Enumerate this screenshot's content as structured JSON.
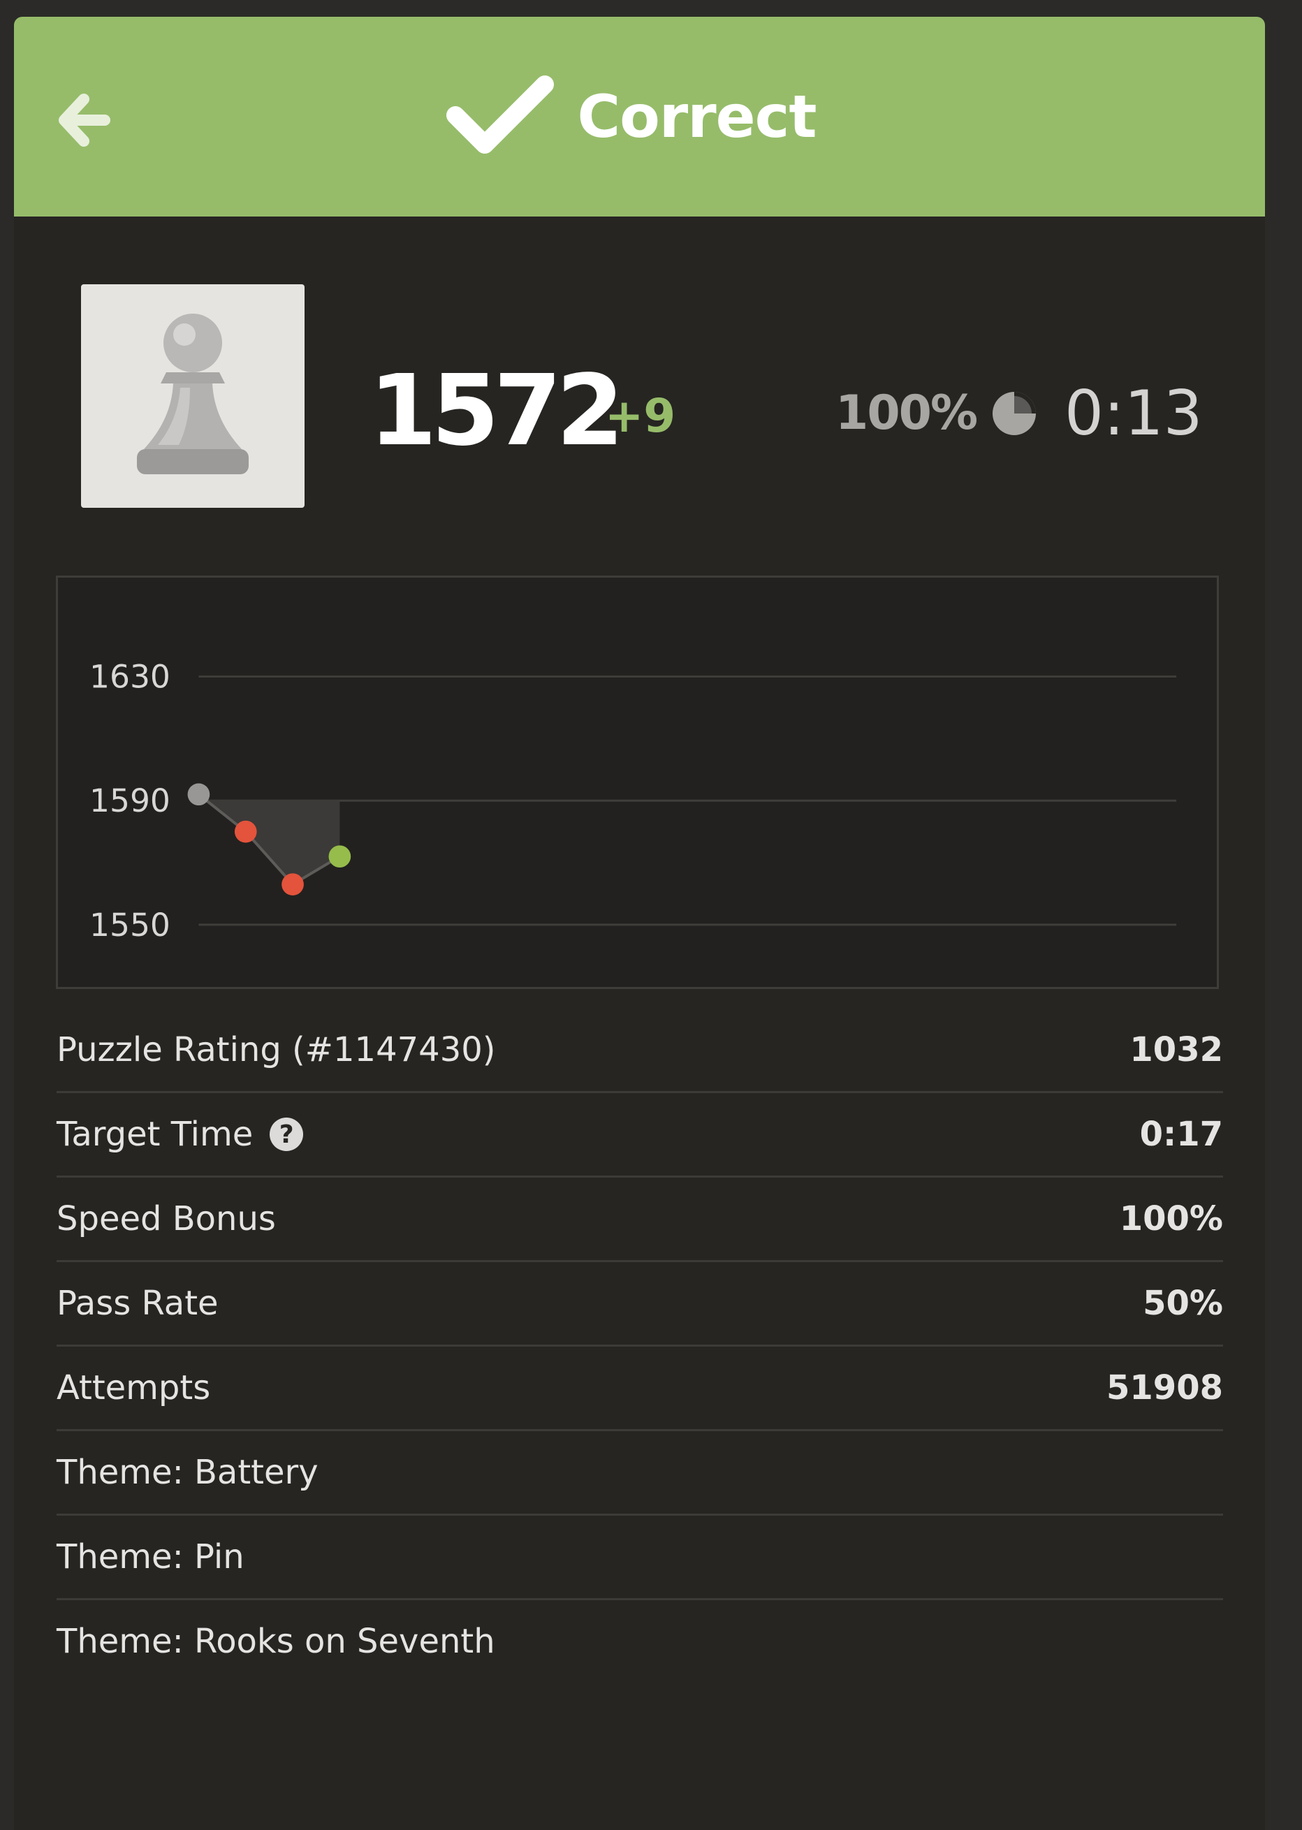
{
  "header": {
    "title": "Correct",
    "back_icon": "arrow-left-icon",
    "status_icon": "checkmark-icon",
    "bg_color": "#96bc6a"
  },
  "summary": {
    "rating": "1572",
    "rating_delta": "+9",
    "accuracy": "100%",
    "time": "0:13",
    "avatar_icon": "pawn-icon",
    "timer_icon": "pie-timer-icon"
  },
  "chart_data": {
    "type": "line",
    "ylim": [
      1550,
      1630
    ],
    "y_ticks": [
      "1630",
      "1590",
      "1550"
    ],
    "grid": true,
    "points": [
      {
        "x": 0,
        "y": 1592,
        "result": "start",
        "color": "#989795"
      },
      {
        "x": 1,
        "y": 1580,
        "result": "incorrect",
        "color": "#e4533c"
      },
      {
        "x": 2,
        "y": 1563,
        "result": "incorrect",
        "color": "#e4533c"
      },
      {
        "x": 3,
        "y": 1572,
        "result": "correct",
        "color": "#96bc4b"
      }
    ]
  },
  "stats": [
    {
      "label": "Puzzle Rating (#1147430)",
      "value": "1032"
    },
    {
      "label": "Target Time",
      "value": "0:17",
      "help_icon": "question-icon",
      "help_text": "?"
    },
    {
      "label": "Speed Bonus",
      "value": "100%"
    },
    {
      "label": "Pass Rate",
      "value": "50%"
    },
    {
      "label": "Attempts",
      "value": "51908"
    },
    {
      "label": "Theme: Battery",
      "value": ""
    },
    {
      "label": "Theme: Pin",
      "value": ""
    },
    {
      "label": "Theme: Rooks on Seventh",
      "value": ""
    }
  ]
}
